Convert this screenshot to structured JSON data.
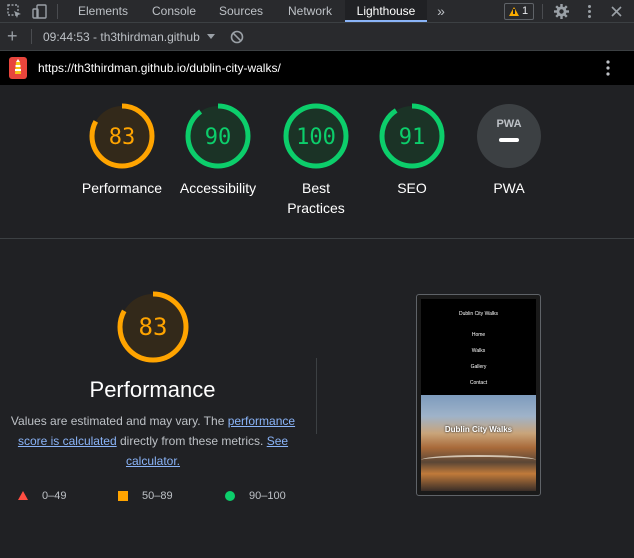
{
  "devtools": {
    "tabs": [
      {
        "label": "Elements"
      },
      {
        "label": "Console"
      },
      {
        "label": "Sources"
      },
      {
        "label": "Network"
      },
      {
        "label": "Lighthouse",
        "active": true
      }
    ],
    "overflow_label": "»",
    "warning_count": "1",
    "icons": [
      "inspect-icon",
      "device-toggle-icon",
      "gear-icon",
      "more-vertical-icon",
      "close-icon"
    ]
  },
  "report_toolbar": {
    "report_label": "09:44:53 - th3thirdman.github",
    "add_label": "+"
  },
  "url_bar": {
    "url": "https://th3thirdman.github.io/dublin-city-walks/"
  },
  "scores": [
    {
      "label": "Performance",
      "value": "83",
      "fraction": 0.83,
      "status": "average"
    },
    {
      "label": "Accessibility",
      "value": "90",
      "fraction": 0.9,
      "status": "pass"
    },
    {
      "label": "Best Practices",
      "value": "100",
      "fraction": 1.0,
      "status": "pass"
    },
    {
      "label": "SEO",
      "value": "91",
      "fraction": 0.91,
      "status": "pass"
    },
    {
      "label": "PWA",
      "value": "",
      "status": "na",
      "badge_text": "PWA"
    }
  ],
  "performance": {
    "value": "83",
    "fraction": 0.83,
    "title": "Performance",
    "desc_prefix": "Values are estimated and may vary. The ",
    "desc_link1": "performance score is calculated",
    "desc_middle": " directly from these metrics. ",
    "desc_link2": "See calculator."
  },
  "legend": [
    {
      "range": "0–49",
      "shape": "triangle",
      "color": "#ff4e42"
    },
    {
      "range": "50–89",
      "shape": "square",
      "color": "#ffa400"
    },
    {
      "range": "90–100",
      "shape": "circle",
      "color": "#0cce6b"
    }
  ],
  "screenshot": {
    "site_title": "Dublin City Walks",
    "nav": [
      "Home",
      "Walks",
      "Gallery",
      "Contact"
    ],
    "hero_text": "Dublin City Walks"
  },
  "colors": {
    "average": "#ffa400",
    "pass": "#0cce6b",
    "fail": "#ff4e42",
    "accent": "#8ab4f8"
  }
}
